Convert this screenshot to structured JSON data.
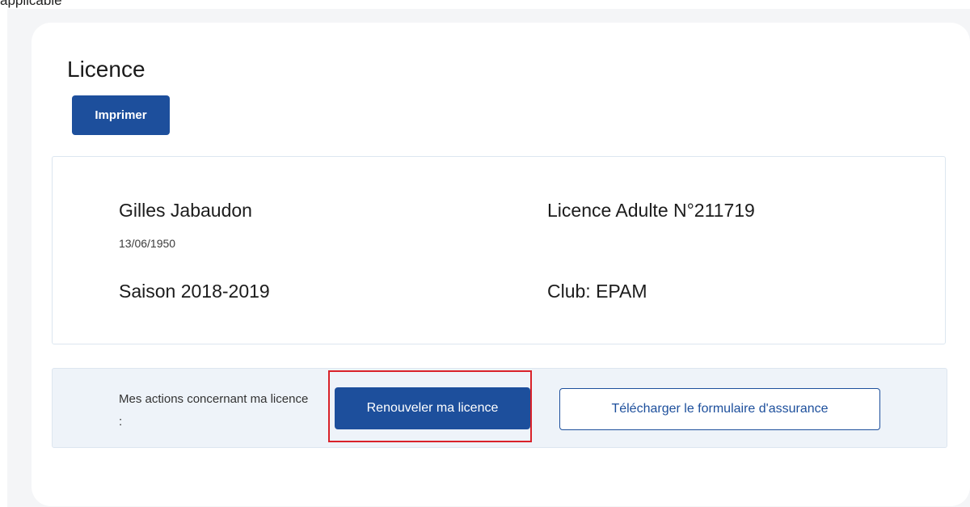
{
  "top_fragment": "applicable",
  "licence": {
    "title": "Licence",
    "print_label": "Imprimer",
    "holder_name": "Gilles Jabaudon",
    "birth_date": "13/06/1950",
    "season": "Saison 2018-2019",
    "licence_number": "Licence Adulte N°211719",
    "club": "Club: EPAM"
  },
  "actions": {
    "label": "Mes actions concernant ma licence :",
    "renew_label": "Renouveler ma licence",
    "download_label": "Télécharger le formulaire d'assurance",
    "highlight_color": "#d9222a",
    "primary_color": "#1d4f9c"
  }
}
